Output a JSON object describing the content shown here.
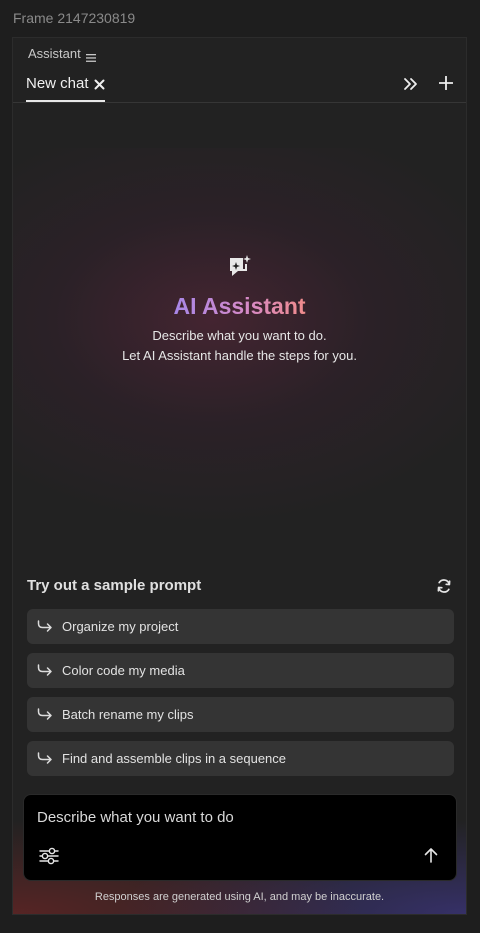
{
  "frame_label": "Frame 2147230819",
  "header": {
    "title": "Assistant",
    "menu_icon": "hamburger-menu-icon"
  },
  "tabs": [
    {
      "label": "New chat",
      "active": true
    }
  ],
  "toolbar": {
    "collapse_icon": "double-chevron-right-icon",
    "add_icon": "plus-icon"
  },
  "hero": {
    "icon": "chat-sparkle-icon",
    "title": "AI Assistant",
    "line1": "Describe what you want to do.",
    "line2": "Let AI Assistant handle the steps for you."
  },
  "sample_prompts": {
    "title": "Try out a sample prompt",
    "refresh_icon": "refresh-icon",
    "items": [
      {
        "label": "Organize my project"
      },
      {
        "label": "Color code my media"
      },
      {
        "label": "Batch rename my clips"
      },
      {
        "label": "Find and assemble clips in a sequence"
      }
    ]
  },
  "composer": {
    "placeholder": "Describe what you want to do",
    "value": "",
    "settings_icon": "sliders-icon",
    "send_icon": "arrow-up-icon"
  },
  "disclaimer": "Responses are generated using AI, and may be inaccurate.",
  "colors": {
    "background": "#1e1e1e",
    "panel": "#222222",
    "prompt_item": "#343434",
    "composer": "#000000",
    "title_gradient_start": "#a787e8",
    "title_gradient_end": "#f08b8b"
  }
}
